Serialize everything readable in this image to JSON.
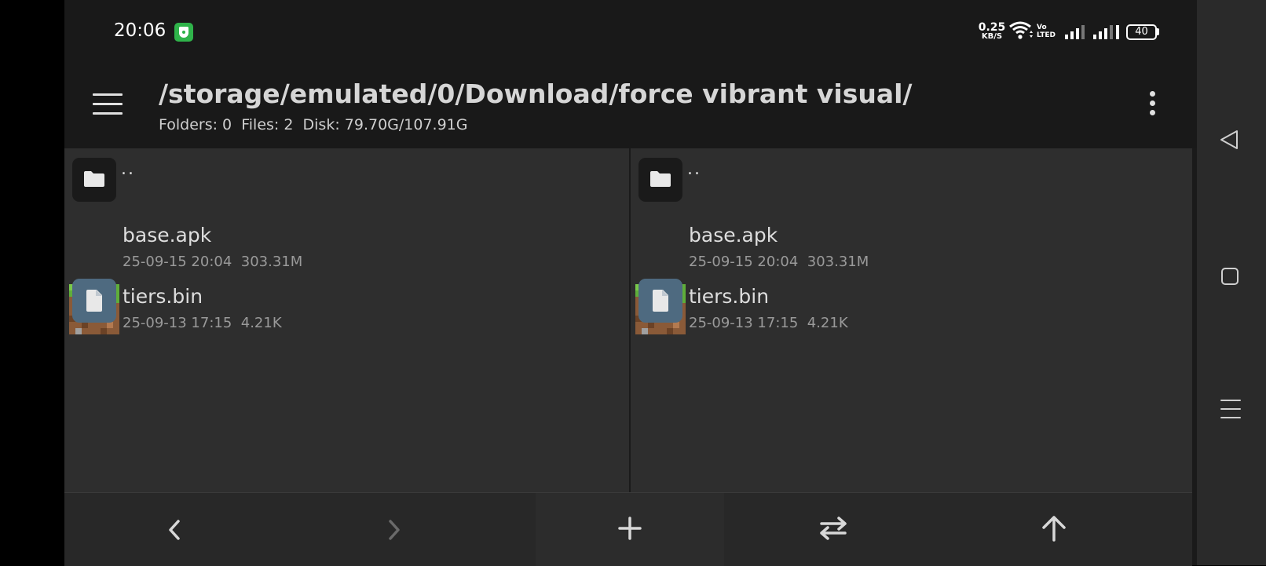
{
  "status_bar": {
    "time": "20:06",
    "net_speed_value": "0.25",
    "net_speed_unit": "KB/S",
    "volte_top": "Vo",
    "volte_bottom": "LTED",
    "battery": "40"
  },
  "toolbar": {
    "path": "/storage/emulated/0/Download/force vibrant visual/",
    "summary": "Folders: 0  Files: 2  Disk: 79.70G/107.91G"
  },
  "panes": [
    {
      "parent_label": "..",
      "files": [
        {
          "name": "base.apk",
          "meta": "25-09-15 20:04  303.31M",
          "icon": "apk-grass-block-icon"
        },
        {
          "name": "tiers.bin",
          "meta": "25-09-13 17:15  4.21K",
          "icon": "file-icon"
        }
      ]
    },
    {
      "parent_label": "..",
      "files": [
        {
          "name": "base.apk",
          "meta": "25-09-15 20:04  303.31M",
          "icon": "apk-grass-block-icon"
        },
        {
          "name": "tiers.bin",
          "meta": "25-09-13 17:15  4.21K",
          "icon": "file-icon"
        }
      ]
    }
  ],
  "bottom_bar": {
    "buttons": [
      "back-icon",
      "forward-icon",
      "add-icon",
      "swap-icon",
      "up-icon"
    ]
  },
  "system_nav": {
    "buttons": [
      "nav-back-icon",
      "nav-home-icon",
      "nav-recents-icon"
    ]
  },
  "colors": {
    "background": "#1a1a1a",
    "pane": "#2e2e2e",
    "file_icon_bg": "#4e6a80",
    "shield_green": "#2fb34a"
  }
}
